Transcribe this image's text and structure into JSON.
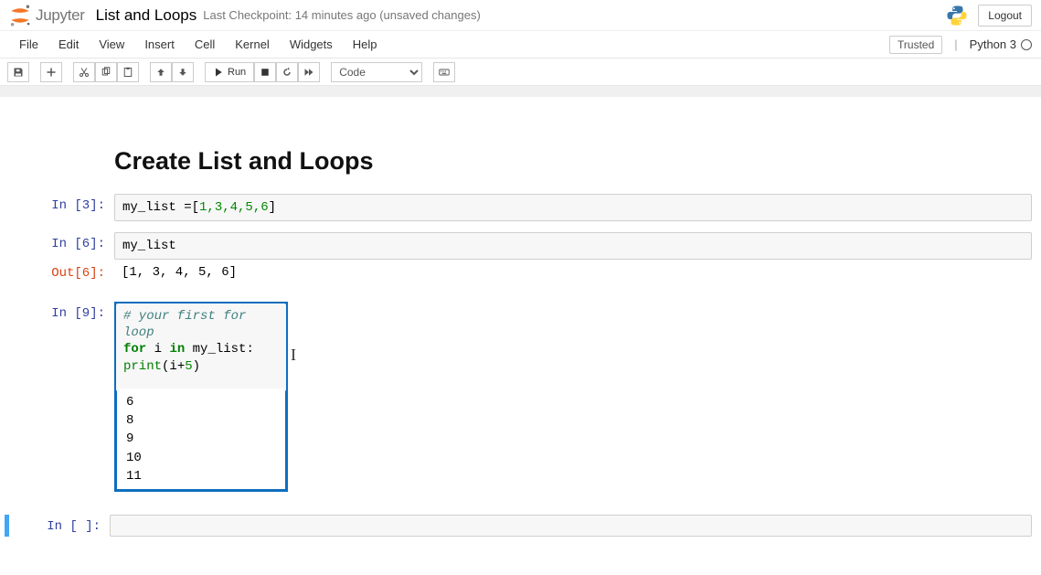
{
  "header": {
    "logo_text": "Jupyter",
    "notebook_name": "List and Loops",
    "checkpoint": "Last Checkpoint: 14 minutes ago  (unsaved changes)",
    "logout": "Logout"
  },
  "menu": {
    "items": [
      "File",
      "Edit",
      "View",
      "Insert",
      "Cell",
      "Kernel",
      "Widgets",
      "Help"
    ],
    "trusted": "Trusted",
    "kernel": "Python 3"
  },
  "toolbar": {
    "run": "Run",
    "celltype": "Code"
  },
  "heading": "Create List and Loops",
  "cells": {
    "c1": {
      "prompt": "In [3]:",
      "code_pre": "my_list =[",
      "nums": "1,3,4,5,6",
      "code_post": "]"
    },
    "c2": {
      "prompt": "In [6]:",
      "code": "my_list",
      "out_prompt": "Out[6]:",
      "out": "[1, 3, 4, 5, 6]"
    },
    "c3": {
      "prompt": "In [9]:",
      "comment": "# your first for loop",
      "kw1": "for",
      "var1": " i ",
      "kw2": "in",
      "var2": " my_list:",
      "indent": "    ",
      "fn": "print",
      "arg_pre": "(i+",
      "arg_num": "5",
      "arg_post": ")",
      "out": "6\n8\n9\n10\n11"
    },
    "c4": {
      "prompt": "In [ ]:"
    }
  }
}
